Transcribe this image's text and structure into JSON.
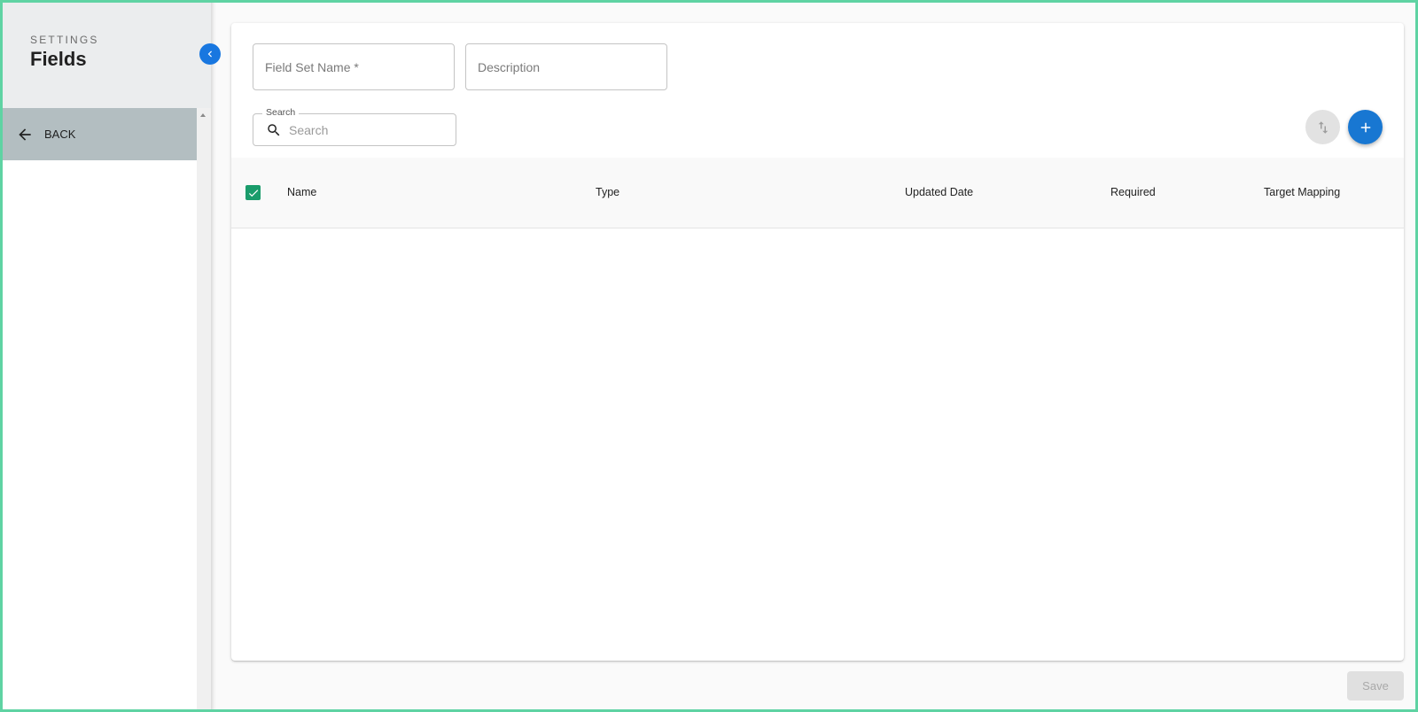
{
  "sidebar": {
    "section_label": "SETTINGS",
    "title": "Fields",
    "back_label": "BACK",
    "collapse_icon": "chevron-left-icon"
  },
  "form": {
    "field_set_name": {
      "placeholder": "Field Set Name *",
      "value": ""
    },
    "description": {
      "placeholder": "Description",
      "value": ""
    },
    "search": {
      "legend": "Search",
      "placeholder": "Search",
      "value": ""
    }
  },
  "toolbar": {
    "sort_icon": "sort-arrows-icon",
    "add_icon": "plus-icon"
  },
  "table": {
    "select_all_checked": true,
    "columns": [
      "Name",
      "Type",
      "Updated Date",
      "Required",
      "Target Mapping"
    ],
    "rows": []
  },
  "footer": {
    "save_label": "Save"
  },
  "colors": {
    "accent": "#1877d2",
    "checkbox": "#1a9c6b",
    "back_item": "#b3bec1",
    "sidebar_header": "#ebedee"
  }
}
